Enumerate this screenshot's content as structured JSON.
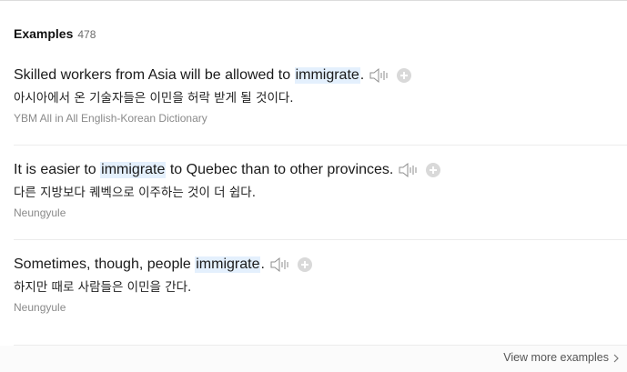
{
  "header": {
    "title": "Examples",
    "count": "478"
  },
  "examples": [
    {
      "en_before": "Skilled workers from Asia will be allowed to ",
      "en_highlight": "immigrate",
      "en_after": ".",
      "ko": "아시아에서 온 기술자들은 이민을 허락 받게 될 것이다.",
      "source": "YBM All in All English-Korean Dictionary"
    },
    {
      "en_before": "It is easier to ",
      "en_highlight": "immigrate",
      "en_after": " to Quebec than to other provinces.",
      "ko": "다른 지방보다 퀘벡으로 이주하는 것이 더 쉽다.",
      "source": "Neungyule"
    },
    {
      "en_before": "Sometimes, though, people ",
      "en_highlight": "immigrate",
      "en_after": ".",
      "ko": "하지만 때로 사람들은 이민을 간다.",
      "source": "Neungyule"
    }
  ],
  "footer": {
    "view_more": "View more examples"
  },
  "icons": {
    "speaker": "speaker-icon",
    "add": "plus-circle-icon",
    "chevron": "chevron-right-icon"
  },
  "colors": {
    "highlight": "#e4f0fd",
    "icon_gray": "#9a9a9a",
    "source_text": "#8a8a8a"
  }
}
